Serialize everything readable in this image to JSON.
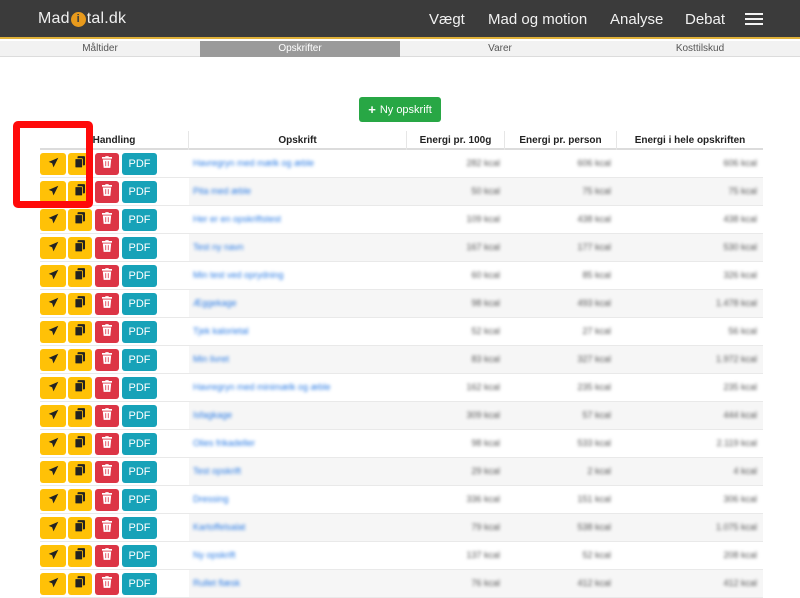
{
  "app": {
    "logo_left": "Mad",
    "logo_dot": "i",
    "logo_right": "tal.dk"
  },
  "nav": {
    "items": [
      "Vægt",
      "Mad og motion",
      "Analyse",
      "Debat"
    ]
  },
  "subnav": {
    "tabs": [
      "Måltider",
      "Opskrifter",
      "Varer",
      "Kosttilskud"
    ],
    "active": "Opskrifter"
  },
  "actions": {
    "new_recipe": "Ny opskrift"
  },
  "table": {
    "headers": [
      "Handling",
      "Opskrift",
      "Energi pr. 100g",
      "Energi pr. person",
      "Energi i hele opskriften"
    ],
    "pdf_label": "PDF",
    "rows": [
      {
        "name": "Havregryn med mælk og æble",
        "per100": "282 kcal",
        "perPerson": "606 kcal",
        "total": "606 kcal"
      },
      {
        "name": "Pita med æble",
        "per100": "50 kcal",
        "perPerson": "75 kcal",
        "total": "75 kcal"
      },
      {
        "name": "Her er en opskriftstest",
        "per100": "109 kcal",
        "perPerson": "438 kcal",
        "total": "438 kcal"
      },
      {
        "name": "Test ny navn",
        "per100": "167 kcal",
        "perPerson": "177 kcal",
        "total": "530 kcal"
      },
      {
        "name": "Min test ved oprydning",
        "per100": "60 kcal",
        "perPerson": "85 kcal",
        "total": "326 kcal"
      },
      {
        "name": "Æggekage",
        "per100": "98 kcal",
        "perPerson": "493 kcal",
        "total": "1.478 kcal"
      },
      {
        "name": "Tjek kalorietal",
        "per100": "52 kcal",
        "perPerson": "27 kcal",
        "total": "56 kcal"
      },
      {
        "name": "Min livret",
        "per100": "83 kcal",
        "perPerson": "327 kcal",
        "total": "1.972 kcal"
      },
      {
        "name": "Havregryn med minimælk og æble",
        "per100": "162 kcal",
        "perPerson": "235 kcal",
        "total": "235 kcal"
      },
      {
        "name": "Isfagkage",
        "per100": "309 kcal",
        "perPerson": "57 kcal",
        "total": "444 kcal"
      },
      {
        "name": "Olies frikadeller",
        "per100": "98 kcal",
        "perPerson": "533 kcal",
        "total": "2.119 kcal"
      },
      {
        "name": "Test opskrift",
        "per100": "29 kcal",
        "perPerson": "2 kcal",
        "total": "4 kcal"
      },
      {
        "name": "Dressing",
        "per100": "336 kcal",
        "perPerson": "151 kcal",
        "total": "306 kcal"
      },
      {
        "name": "Kartoffelsalat",
        "per100": "79 kcal",
        "perPerson": "538 kcal",
        "total": "1.075 kcal"
      },
      {
        "name": "Ny opskrift",
        "per100": "137 kcal",
        "perPerson": "52 kcal",
        "total": "208 kcal"
      },
      {
        "name": "Rullet flæsk",
        "per100": "76 kcal",
        "perPerson": "412 kcal",
        "total": "412 kcal"
      }
    ]
  },
  "icons": {
    "send": "paper-plane-icon",
    "copy": "copy-icon",
    "delete": "trash-icon",
    "menu": "hamburger-icon"
  },
  "colors": {
    "header": "#3b3b3b",
    "new": "#28a745",
    "send": "#ffc107",
    "delete": "#dc3545",
    "pdf": "#17a2b8",
    "link": "#2a7be4",
    "highlight": "#ff0a0a"
  }
}
